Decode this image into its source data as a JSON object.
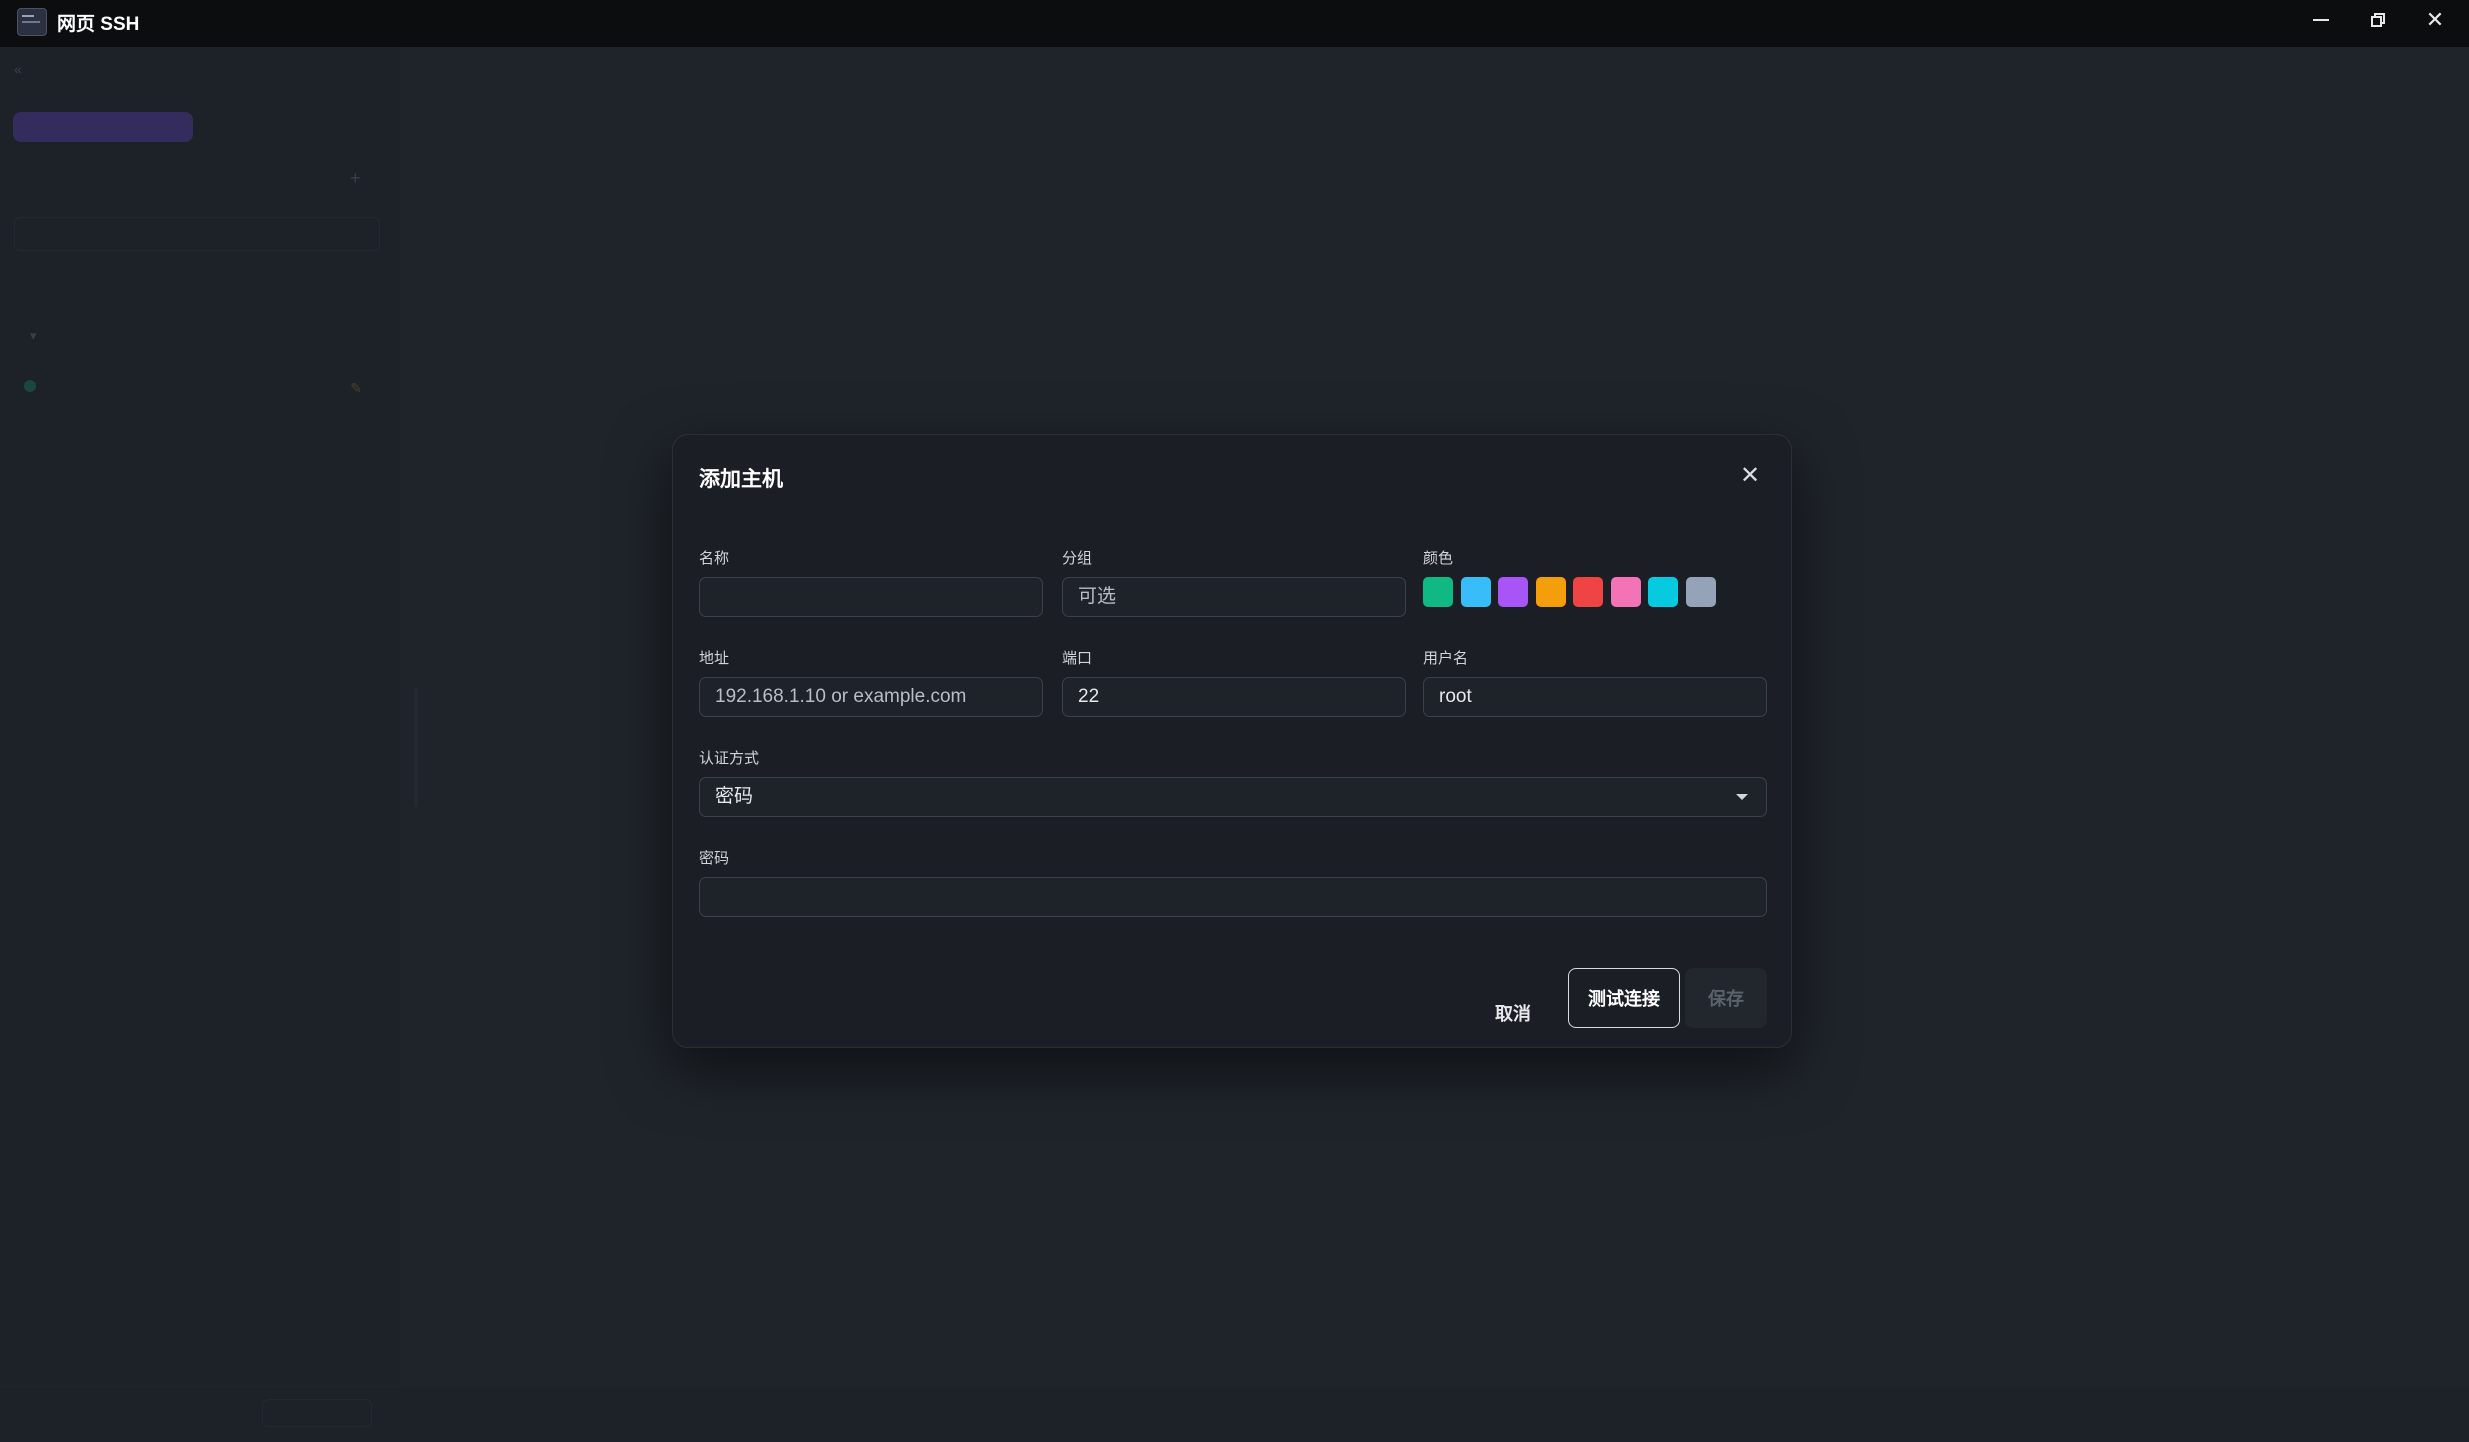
{
  "window": {
    "title": "网页 SSH",
    "minimize_icon": "minimize-icon",
    "maximize_icon": "restore-icon",
    "close_icon": "close-icon"
  },
  "dialog": {
    "title": "添加主机",
    "fields": {
      "name": {
        "label": "名称",
        "value": "",
        "placeholder": ""
      },
      "group": {
        "label": "分组",
        "value": "",
        "placeholder": "可选"
      },
      "color": {
        "label": "颜色",
        "options": [
          "#10b981",
          "#38bdf8",
          "#a855f7",
          "#f59e0b",
          "#ef4444",
          "#f472b6",
          "#06cbe0",
          "#94a3b8"
        ]
      },
      "address": {
        "label": "地址",
        "value": "",
        "placeholder": "192.168.1.10 or example.com"
      },
      "port": {
        "label": "端口",
        "value": "22"
      },
      "username": {
        "label": "用户名",
        "value": "root"
      },
      "auth": {
        "label": "认证方式",
        "value": "密码"
      },
      "password": {
        "label": "密码",
        "value": ""
      }
    },
    "buttons": {
      "cancel": "取消",
      "test": "测试连接",
      "save": "保存"
    }
  }
}
